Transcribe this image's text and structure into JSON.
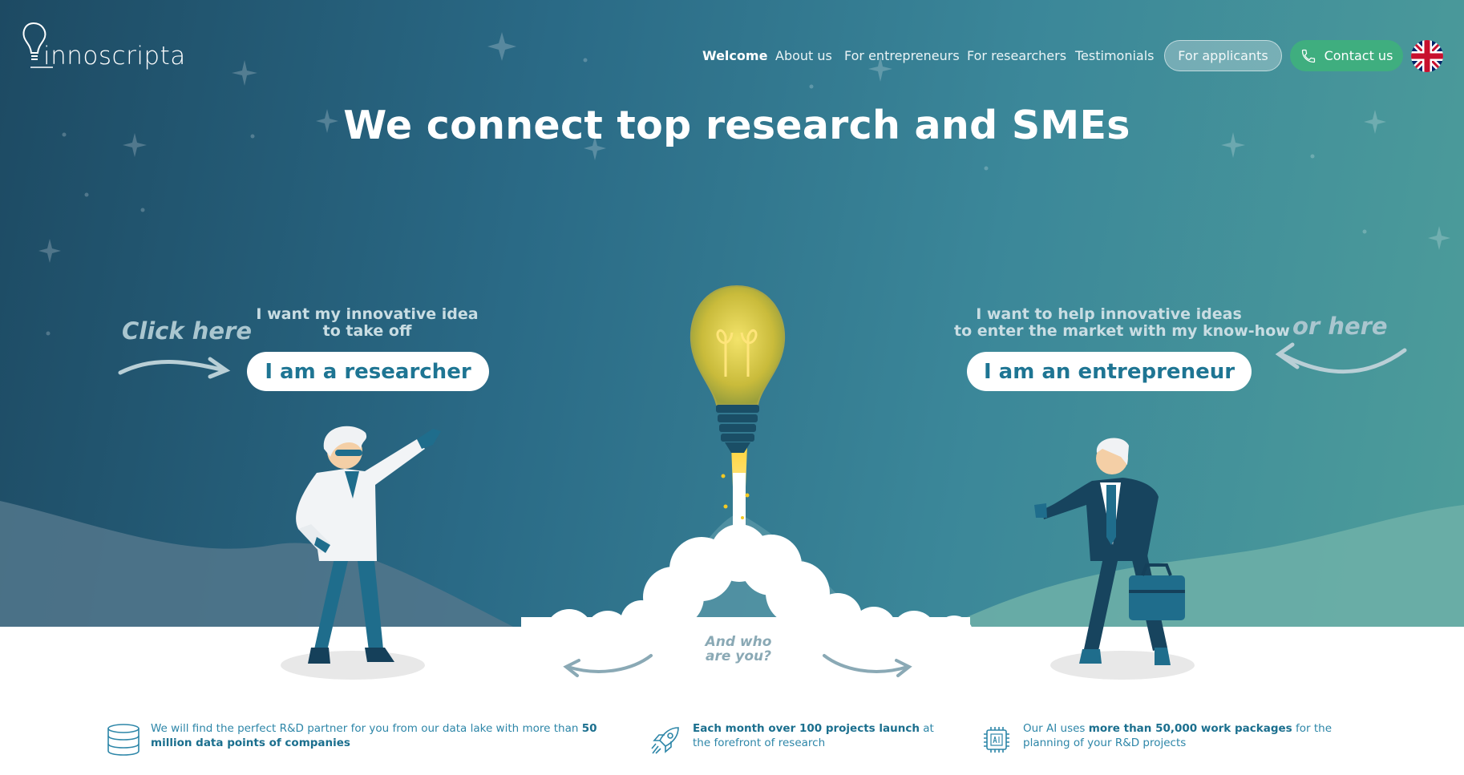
{
  "logo": {
    "text": "innoscripta"
  },
  "nav": {
    "links": [
      {
        "label": "Welcome",
        "active": true
      },
      {
        "label": "About us"
      },
      {
        "label": "For entrepreneurs"
      },
      {
        "label": "For researchers"
      },
      {
        "label": "Testimonials"
      }
    ],
    "applicants_label": "For applicants",
    "contact_label": "Contact us",
    "language_icon": "uk-flag-icon"
  },
  "hero": {
    "headline": "We connect top research and SMEs",
    "researcher": {
      "prompt_line1": "I want my innovative idea",
      "prompt_line2": "to take off",
      "button": "I am a researcher",
      "hint": "Click here"
    },
    "entrepreneur": {
      "prompt_line1": "I want to help innovative ideas",
      "prompt_line2": "to enter the market with my know-how",
      "button": "I am an entrepreneur",
      "hint": "or here"
    },
    "question_line1": "And who",
    "question_line2": "are you?"
  },
  "features": [
    {
      "icon": "database-icon",
      "text_before": "We will find the perfect R&D partner for you from our data lake with more than ",
      "text_bold": "50 million data points of companies",
      "text_after": ""
    },
    {
      "icon": "rocket-icon",
      "text_before": "",
      "text_bold": "Each month over 100 projects launch",
      "text_after": " at the forefront of research"
    },
    {
      "icon": "ai-chip-icon",
      "text_before": "Our AI uses ",
      "text_bold": "more than 50,000 work packages",
      "text_after": " for the planning of your R&D projects"
    }
  ],
  "colors": {
    "accent_teal": "#1e7593",
    "contact_green": "#3fae7f",
    "feature_text": "#2d86a8"
  }
}
